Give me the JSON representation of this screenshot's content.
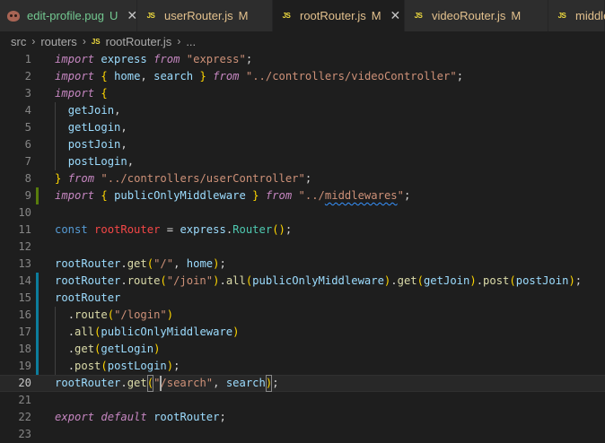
{
  "tabs": [
    {
      "name": "edit-profile.pug",
      "status": "U",
      "icon": "pug-icon",
      "state": "untracked",
      "active": false,
      "close": true
    },
    {
      "name": "userRouter.js",
      "status": "M",
      "icon": "js-icon",
      "state": "modified",
      "active": false,
      "close": false
    },
    {
      "name": "rootRouter.js",
      "status": "M",
      "icon": "js-icon",
      "state": "modified",
      "active": true,
      "close": true
    },
    {
      "name": "videoRouter.js",
      "status": "M",
      "icon": "js-icon",
      "state": "modified",
      "active": false,
      "close": false
    },
    {
      "name": "middlewares.js",
      "status": "",
      "icon": "js-icon",
      "state": "modified",
      "active": false,
      "close": false
    }
  ],
  "icon_labels": {
    "js": "JS"
  },
  "breadcrumb": {
    "parts": [
      "src",
      "routers",
      "rootRouter.js",
      "..."
    ]
  },
  "editor": {
    "current_line": 20,
    "lines": [
      {
        "n": "1",
        "mark": "",
        "tokens": [
          [
            "kw",
            "import"
          ],
          [
            "plain",
            " "
          ],
          [
            "var",
            "express"
          ],
          [
            "plain",
            " "
          ],
          [
            "kw",
            "from"
          ],
          [
            "plain",
            " "
          ],
          [
            "str",
            "\"express\""
          ],
          [
            "punc",
            ";"
          ]
        ]
      },
      {
        "n": "2",
        "mark": "",
        "tokens": [
          [
            "kw",
            "import"
          ],
          [
            "plain",
            " "
          ],
          [
            "br1",
            "{"
          ],
          [
            "plain",
            " "
          ],
          [
            "var",
            "home"
          ],
          [
            "punc",
            ","
          ],
          [
            "plain",
            " "
          ],
          [
            "var",
            "search"
          ],
          [
            "plain",
            " "
          ],
          [
            "br1",
            "}"
          ],
          [
            "plain",
            " "
          ],
          [
            "kw",
            "from"
          ],
          [
            "plain",
            " "
          ],
          [
            "str",
            "\"../controllers/videoController\""
          ],
          [
            "punc",
            ";"
          ]
        ]
      },
      {
        "n": "3",
        "mark": "",
        "tokens": [
          [
            "kw",
            "import"
          ],
          [
            "plain",
            " "
          ],
          [
            "br1",
            "{"
          ]
        ]
      },
      {
        "n": "4",
        "mark": "",
        "tokens": [
          [
            "plain",
            "  "
          ],
          [
            "var",
            "getJoin"
          ],
          [
            "punc",
            ","
          ]
        ]
      },
      {
        "n": "5",
        "mark": "",
        "tokens": [
          [
            "plain",
            "  "
          ],
          [
            "var",
            "getLogin"
          ],
          [
            "punc",
            ","
          ]
        ]
      },
      {
        "n": "6",
        "mark": "",
        "tokens": [
          [
            "plain",
            "  "
          ],
          [
            "var",
            "postJoin"
          ],
          [
            "punc",
            ","
          ]
        ]
      },
      {
        "n": "7",
        "mark": "",
        "tokens": [
          [
            "plain",
            "  "
          ],
          [
            "var",
            "postLogin"
          ],
          [
            "punc",
            ","
          ]
        ]
      },
      {
        "n": "8",
        "mark": "",
        "tokens": [
          [
            "br1",
            "}"
          ],
          [
            "plain",
            " "
          ],
          [
            "kw",
            "from"
          ],
          [
            "plain",
            " "
          ],
          [
            "str",
            "\"../controllers/userController\""
          ],
          [
            "punc",
            ";"
          ]
        ]
      },
      {
        "n": "9",
        "mark": "added",
        "tokens": [
          [
            "kw",
            "import"
          ],
          [
            "plain",
            " "
          ],
          [
            "br1",
            "{"
          ],
          [
            "plain",
            " "
          ],
          [
            "var",
            "publicOnlyMiddleware"
          ],
          [
            "plain",
            " "
          ],
          [
            "br1",
            "}"
          ],
          [
            "plain",
            " "
          ],
          [
            "kw",
            "from"
          ],
          [
            "plain",
            " "
          ],
          [
            "str",
            "\"../"
          ],
          [
            "strsq",
            "middlewares"
          ],
          [
            "str",
            "\""
          ],
          [
            "punc",
            ";"
          ]
        ]
      },
      {
        "n": "10",
        "mark": "",
        "tokens": []
      },
      {
        "n": "11",
        "mark": "",
        "tokens": [
          [
            "decl",
            "const"
          ],
          [
            "plain",
            " "
          ],
          [
            "constred",
            "rootRouter"
          ],
          [
            "plain",
            " "
          ],
          [
            "punc",
            "="
          ],
          [
            "plain",
            " "
          ],
          [
            "var",
            "express"
          ],
          [
            "punc",
            "."
          ],
          [
            "type",
            "Router"
          ],
          [
            "br1",
            "("
          ],
          [
            "br1",
            ")"
          ],
          [
            "punc",
            ";"
          ]
        ]
      },
      {
        "n": "12",
        "mark": "",
        "tokens": []
      },
      {
        "n": "13",
        "mark": "",
        "tokens": [
          [
            "var",
            "rootRouter"
          ],
          [
            "punc",
            "."
          ],
          [
            "fn",
            "get"
          ],
          [
            "br1",
            "("
          ],
          [
            "str",
            "\"/\""
          ],
          [
            "punc",
            ","
          ],
          [
            "plain",
            " "
          ],
          [
            "var",
            "home"
          ],
          [
            "br1",
            ")"
          ],
          [
            "punc",
            ";"
          ]
        ]
      },
      {
        "n": "14",
        "mark": "modified",
        "tokens": [
          [
            "var",
            "rootRouter"
          ],
          [
            "punc",
            "."
          ],
          [
            "fn",
            "route"
          ],
          [
            "br1",
            "("
          ],
          [
            "str",
            "\"/join\""
          ],
          [
            "br1",
            ")"
          ],
          [
            "punc",
            "."
          ],
          [
            "fn",
            "all"
          ],
          [
            "br1",
            "("
          ],
          [
            "var",
            "publicOnlyMiddleware"
          ],
          [
            "br1",
            ")"
          ],
          [
            "punc",
            "."
          ],
          [
            "fn",
            "get"
          ],
          [
            "br1",
            "("
          ],
          [
            "var",
            "getJoin"
          ],
          [
            "br1",
            ")"
          ],
          [
            "punc",
            "."
          ],
          [
            "fn",
            "post"
          ],
          [
            "br1",
            "("
          ],
          [
            "var",
            "postJoin"
          ],
          [
            "br1",
            ")"
          ],
          [
            "punc",
            ";"
          ]
        ]
      },
      {
        "n": "15",
        "mark": "modified",
        "tokens": [
          [
            "var",
            "rootRouter"
          ]
        ]
      },
      {
        "n": "16",
        "mark": "modified",
        "tokens": [
          [
            "plain",
            "  "
          ],
          [
            "punc",
            "."
          ],
          [
            "fn",
            "route"
          ],
          [
            "br1",
            "("
          ],
          [
            "str",
            "\"/login\""
          ],
          [
            "br1",
            ")"
          ]
        ]
      },
      {
        "n": "17",
        "mark": "modified",
        "tokens": [
          [
            "plain",
            "  "
          ],
          [
            "punc",
            "."
          ],
          [
            "fn",
            "all"
          ],
          [
            "br1",
            "("
          ],
          [
            "var",
            "publicOnlyMiddleware"
          ],
          [
            "br1",
            ")"
          ]
        ]
      },
      {
        "n": "18",
        "mark": "modified",
        "tokens": [
          [
            "plain",
            "  "
          ],
          [
            "punc",
            "."
          ],
          [
            "fn",
            "get"
          ],
          [
            "br1",
            "("
          ],
          [
            "var",
            "getLogin"
          ],
          [
            "br1",
            ")"
          ]
        ]
      },
      {
        "n": "19",
        "mark": "modified",
        "tokens": [
          [
            "plain",
            "  "
          ],
          [
            "punc",
            "."
          ],
          [
            "fn",
            "post"
          ],
          [
            "br1",
            "("
          ],
          [
            "var",
            "postLogin"
          ],
          [
            "br1",
            ")"
          ],
          [
            "punc",
            ";"
          ]
        ]
      },
      {
        "n": "20",
        "mark": "",
        "tokens": [
          [
            "var",
            "rootRouter"
          ],
          [
            "punc",
            "."
          ],
          [
            "fn",
            "get"
          ],
          [
            "brhl",
            "("
          ],
          [
            "str",
            "\"/search\""
          ],
          [
            "punc",
            ","
          ],
          [
            "plain",
            " "
          ],
          [
            "var",
            "search"
          ],
          [
            "brhl",
            ")"
          ],
          [
            "punc",
            ";"
          ]
        ]
      },
      {
        "n": "21",
        "mark": "",
        "tokens": []
      },
      {
        "n": "22",
        "mark": "",
        "tokens": [
          [
            "kw",
            "export"
          ],
          [
            "plain",
            " "
          ],
          [
            "kw",
            "default"
          ],
          [
            "plain",
            " "
          ],
          [
            "var",
            "rootRouter"
          ],
          [
            "punc",
            ";"
          ]
        ]
      },
      {
        "n": "23",
        "mark": "",
        "tokens": []
      }
    ]
  },
  "colors": {
    "background": "#1e1e1e",
    "tabbar": "#252526",
    "keyword": "#c586c0",
    "string": "#ce9178",
    "variable": "#9cdcfe",
    "function": "#dcdcaa",
    "git_added": "#587c0c",
    "git_modified": "#0c7d9d"
  }
}
